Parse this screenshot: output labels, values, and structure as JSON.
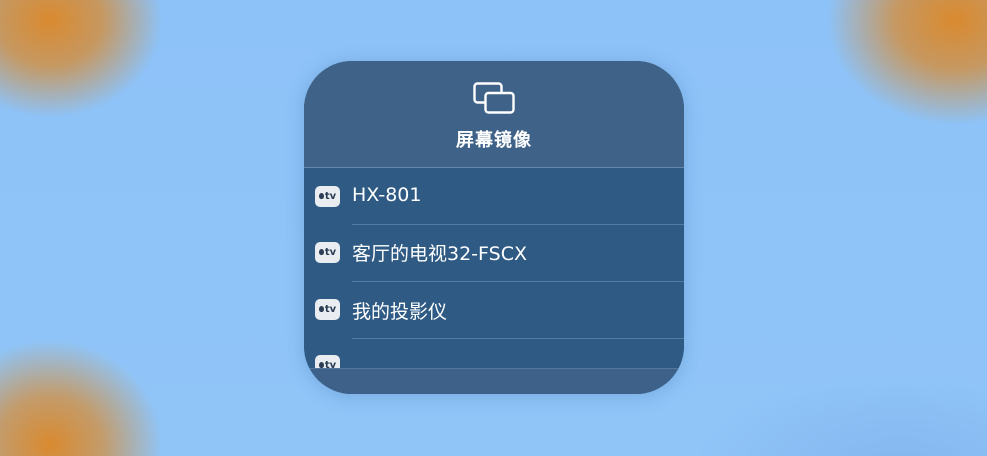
{
  "screen_mirroring": {
    "title": "屏幕镜像",
    "icon": "screen-mirroring-icon",
    "devices": [
      {
        "badge": "tv",
        "name": "HX-801"
      },
      {
        "badge": "tv",
        "name": "客厅的电视32-FSCX"
      },
      {
        "badge": "tv",
        "name": "我的投影仪"
      },
      {
        "badge": "tv",
        "name": ""
      }
    ]
  },
  "colors": {
    "panel_background": "#3d6188",
    "list_background": "#2e5a84",
    "wallpaper_blue": "#8ec3f7",
    "wallpaper_orange": "#d98a2f"
  }
}
